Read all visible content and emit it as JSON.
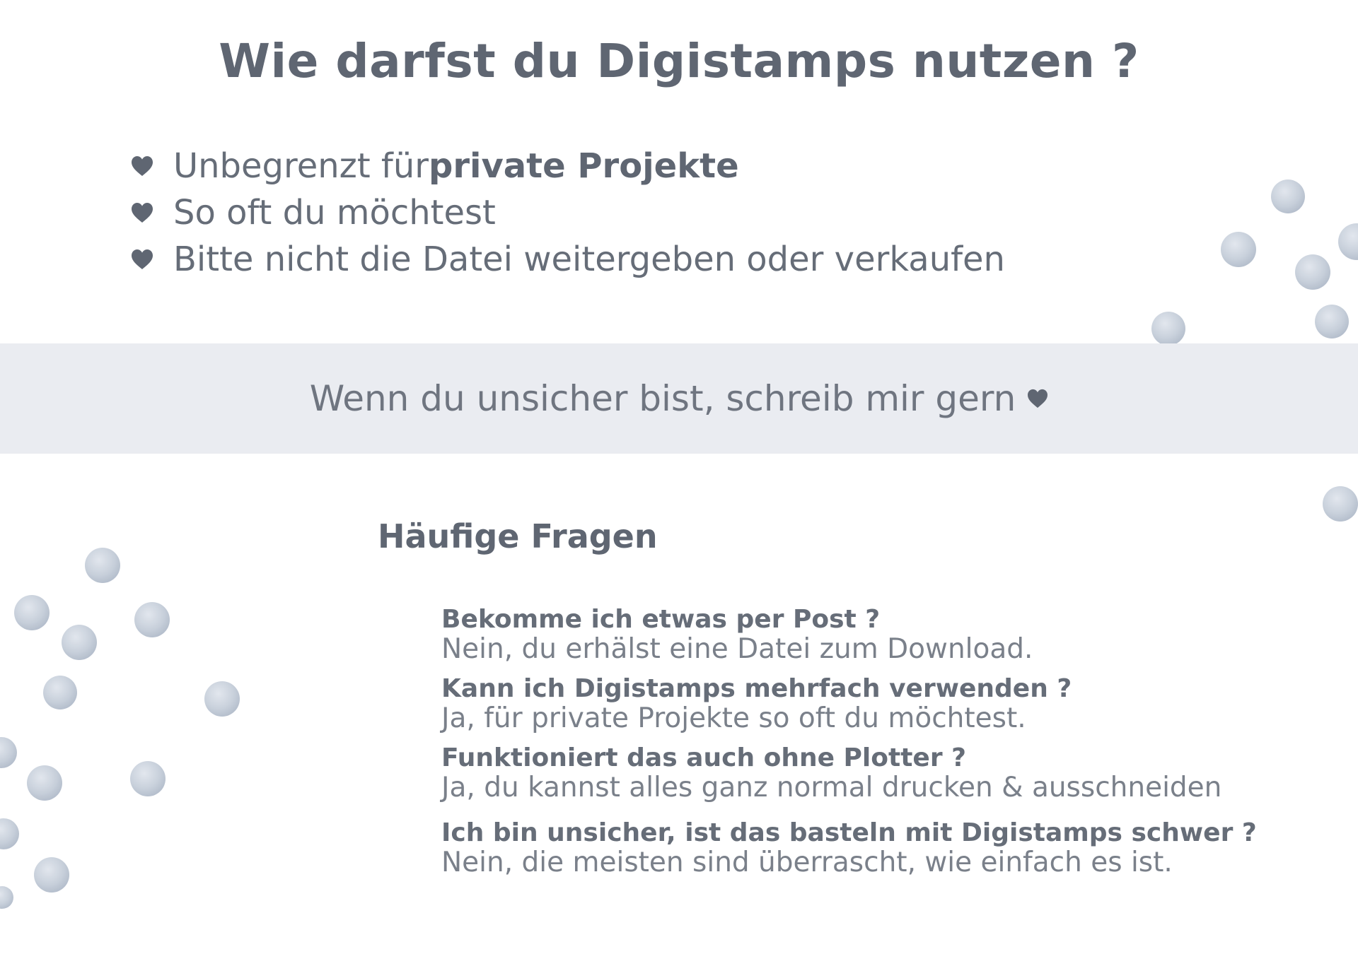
{
  "title": "Wie darfst du Digistamps nutzen ?",
  "usage": [
    {
      "text": "Unbegrenzt für ",
      "bold": "private Projekte",
      "icon": "heart-icon"
    },
    {
      "text": "So oft du möchtest",
      "bold": "",
      "icon": "heart-icon"
    },
    {
      "text": "Bitte nicht die Datei weitergeben oder verkaufen",
      "bold": "",
      "icon": "heart-icon"
    }
  ],
  "banner": {
    "text": "Wenn du unsicher bist, schreib mir gern",
    "icon": "heart-icon"
  },
  "faq": {
    "heading": "Häufige Fragen",
    "items": [
      {
        "question": "Bekomme ich etwas per Post ?",
        "answer": "Nein, du erhälst eine Datei zum Download."
      },
      {
        "question": "Kann ich Digistamps mehrfach verwenden ?",
        "answer": "Ja, für private Projekte so oft du möchtest."
      },
      {
        "question": "Funktioniert das auch ohne Plotter ?",
        "answer": "Ja, du kannst alles ganz normal drucken & ausschneiden"
      },
      {
        "question": "Ich bin unsicher, ist das basteln mit Digistamps schwer ?",
        "answer": "Nein, die meisten sind überrascht, wie einfach es ist."
      }
    ]
  },
  "colors": {
    "text": "#666d78",
    "heading": "#5f6672",
    "band": "#eaecf1",
    "dots": "#b9c3d1"
  }
}
